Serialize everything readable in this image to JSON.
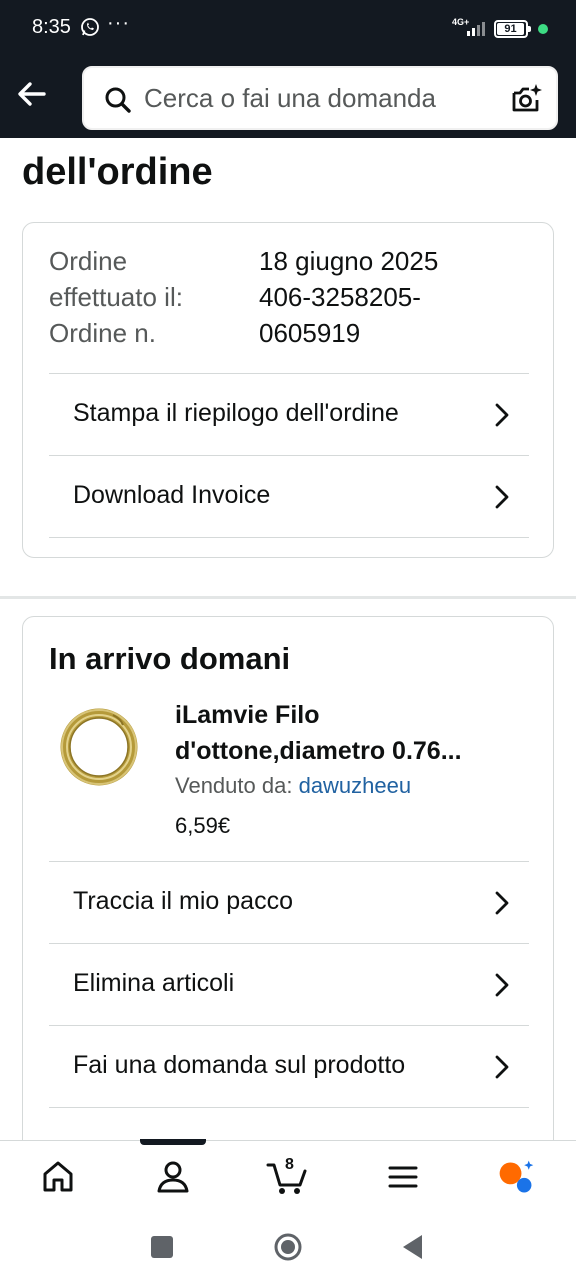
{
  "status_bar": {
    "time": "8:35",
    "more_indicator": "···",
    "network": "4G+",
    "battery": "91"
  },
  "search": {
    "placeholder": "Cerca o fai una domanda"
  },
  "page": {
    "title": "dell'ordine"
  },
  "order_info": {
    "date_label_line1": "Ordine",
    "date_label_line2": "effettuato il:",
    "date_value": "18 giugno 2025",
    "number_label": "Ordine n.",
    "number_value_line1": "406-3258205-",
    "number_value_line2": "0605919"
  },
  "order_actions": [
    {
      "label": "Stampa il riepilogo dell'ordine"
    },
    {
      "label": "Download Invoice"
    }
  ],
  "delivery": {
    "title": "In arrivo domani",
    "product_name_line1": "iLamvie Filo",
    "product_name_line2": "d'ottone,diametro 0.76...",
    "seller_label": "Venduto da:",
    "seller_name": "dawuzheeu",
    "price": "6,59€"
  },
  "delivery_actions": [
    {
      "label": "Traccia il mio pacco"
    },
    {
      "label": "Elimina articoli"
    },
    {
      "label": "Fai una domanda sul prodotto"
    }
  ],
  "bottom_nav": {
    "cart_count": "8"
  },
  "icons": {
    "back": "arrow-left-icon",
    "search": "search-icon",
    "camera": "camera-search-icon",
    "home": "home-icon",
    "account": "account-icon",
    "cart": "cart-icon",
    "menu": "menu-icon",
    "rufus": "rufus-icon"
  },
  "colors": {
    "header_bg": "#131921",
    "link": "#2162a1",
    "rufus_orange": "#ff6a00",
    "rufus_blue": "#1a73e8"
  }
}
